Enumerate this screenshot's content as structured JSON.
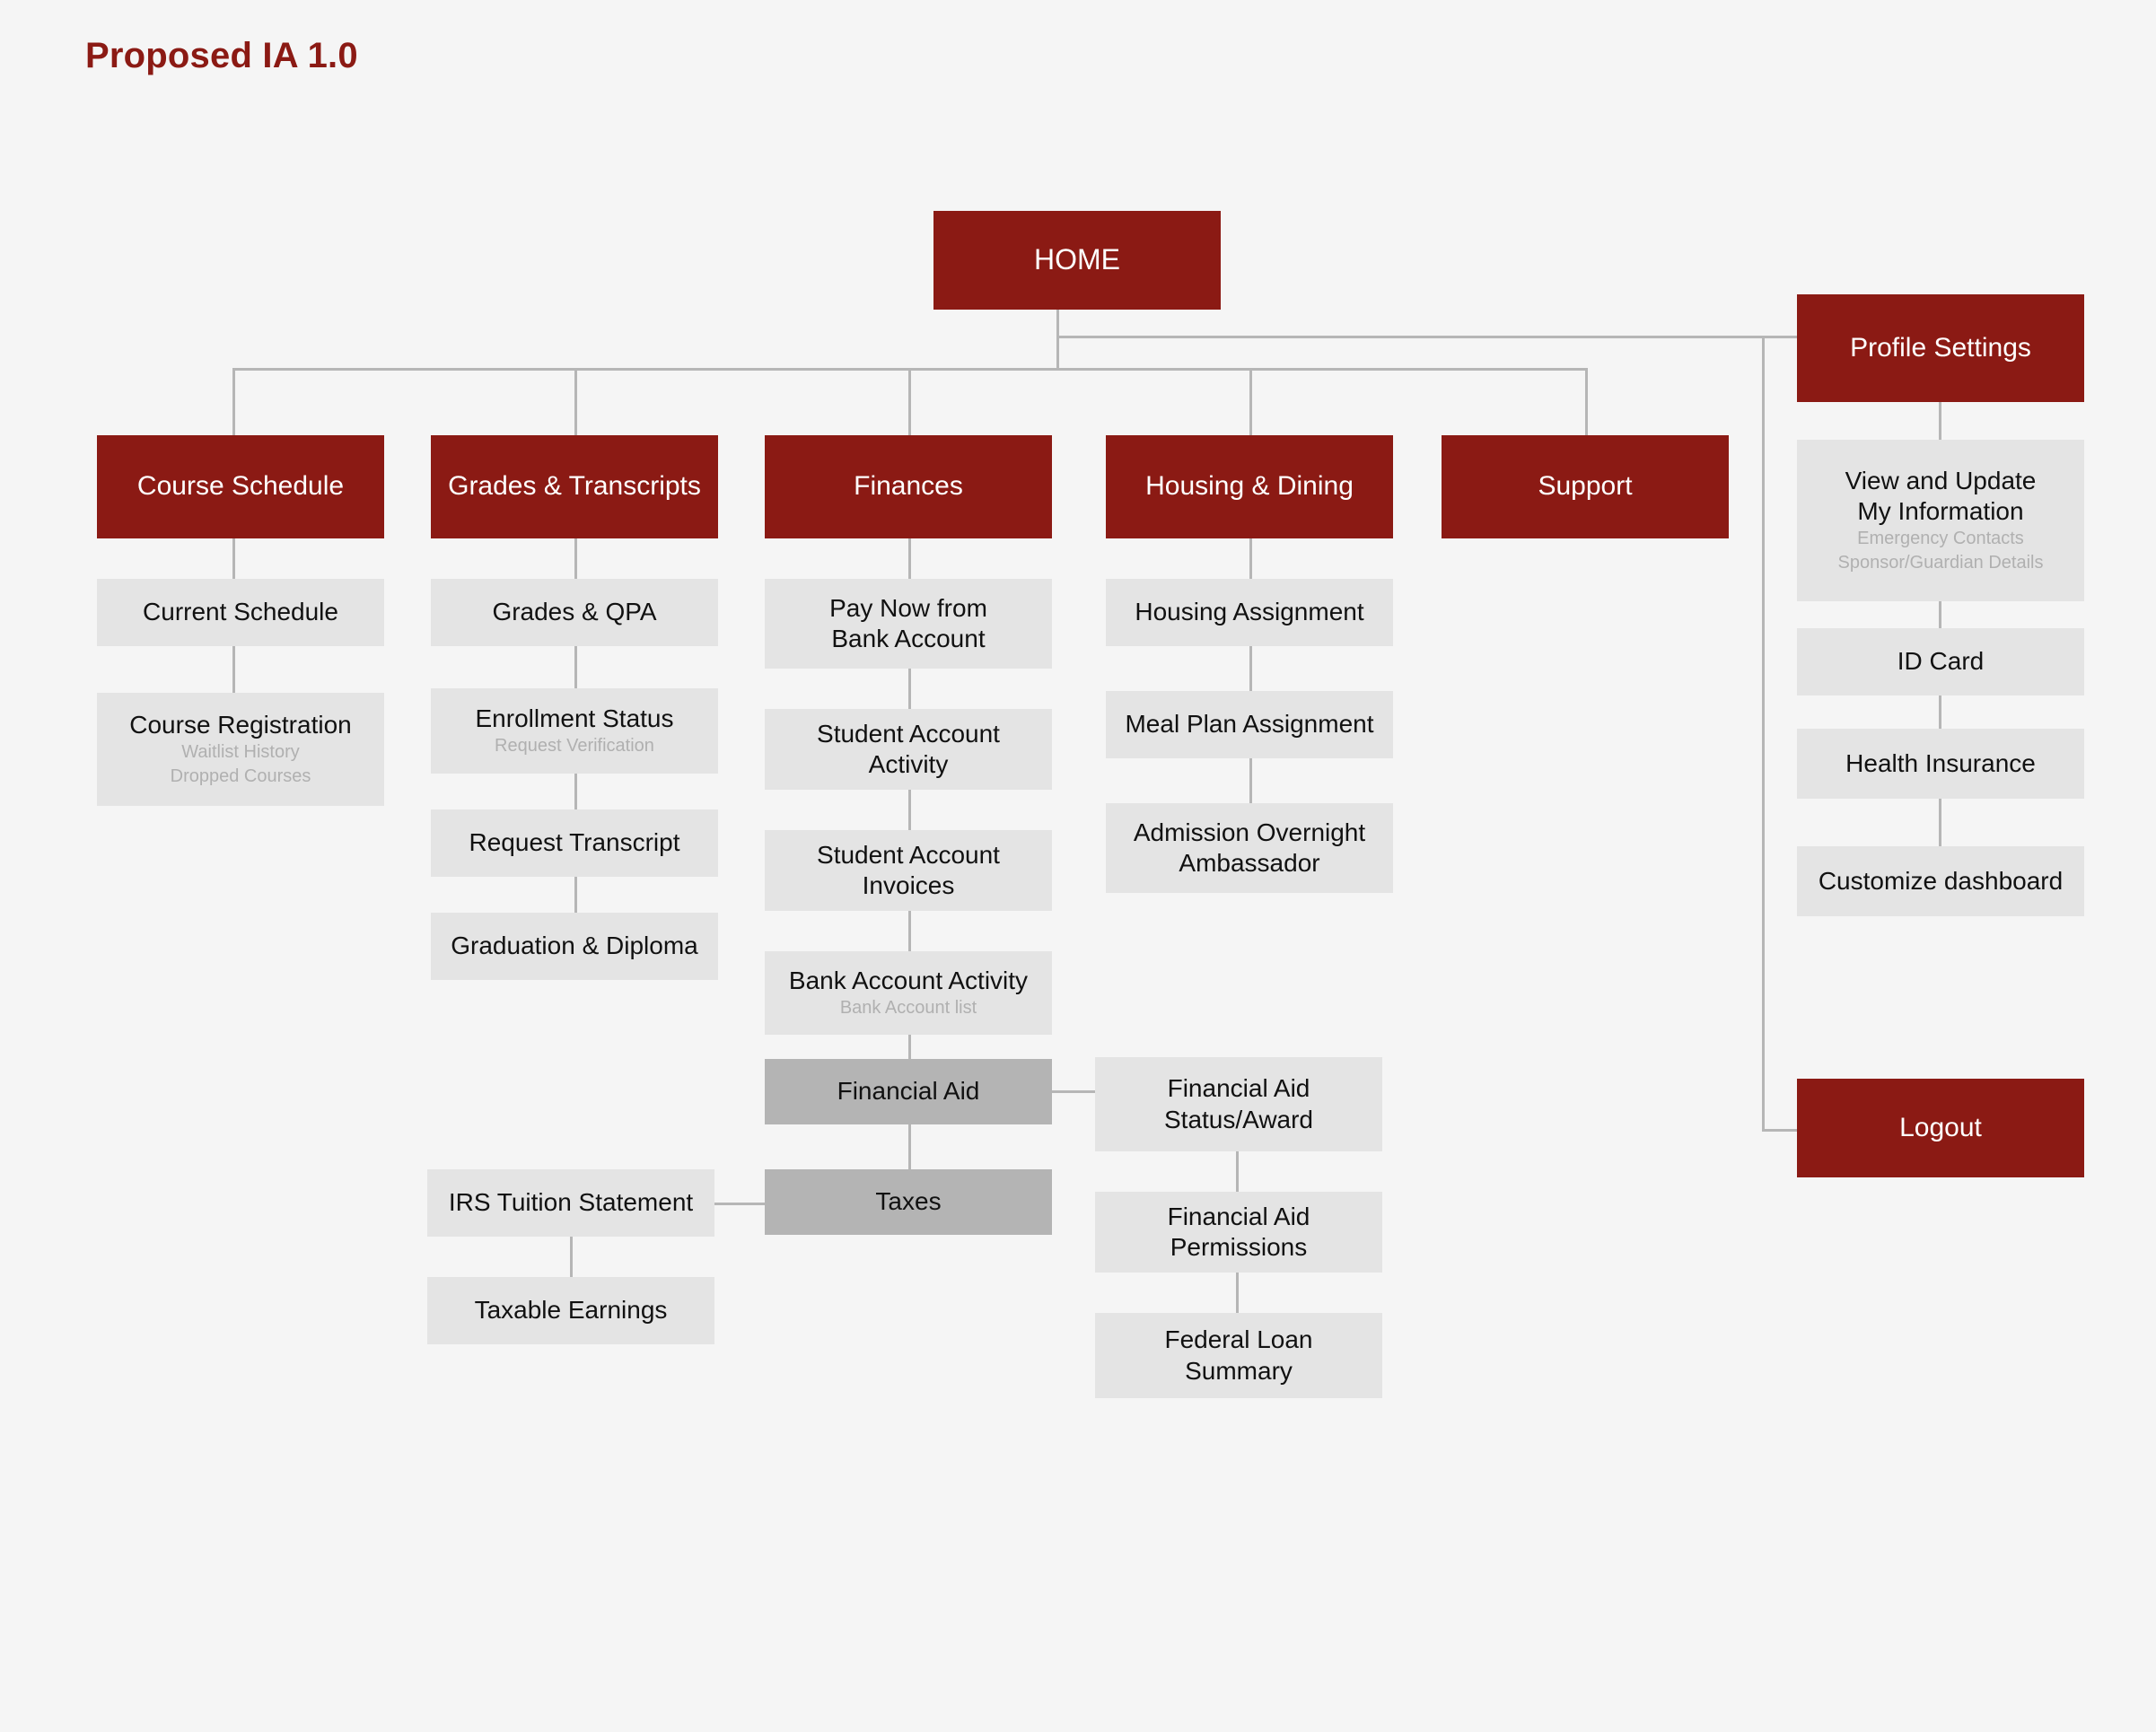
{
  "page": {
    "title": "Proposed IA 1.0",
    "background_color": "#f5f5f5"
  },
  "colors": {
    "primary_red": "#8B1A14",
    "light_box": "#e4e4e4",
    "dark_box": "#b4b4b4",
    "connector": "#b6b6b6",
    "sub_text": "#b0b0b0",
    "text": "#111111",
    "red_text": "#ffffff"
  },
  "root": {
    "label": "HOME"
  },
  "top_level": [
    {
      "label": "Course Schedule"
    },
    {
      "label": "Grades & Transcripts"
    },
    {
      "label": "Finances"
    },
    {
      "label": "Housing & Dining"
    },
    {
      "label": "Support"
    },
    {
      "label": "Profile Settings"
    }
  ],
  "course_schedule": {
    "parent": "Course Schedule",
    "children": [
      {
        "label": "Current Schedule",
        "sub": []
      },
      {
        "label": "Course Registration",
        "sub": [
          "Waitlist History",
          "Dropped Courses"
        ]
      }
    ]
  },
  "grades_transcripts": {
    "parent": "Grades & Transcripts",
    "children": [
      {
        "label": "Grades & QPA",
        "sub": []
      },
      {
        "label": "Enrollment Status",
        "sub": [
          "Request Verification"
        ]
      },
      {
        "label": "Request Transcript",
        "sub": []
      },
      {
        "label": "Graduation & Diploma",
        "sub": []
      }
    ]
  },
  "finances": {
    "parent": "Finances",
    "children": [
      {
        "label": "Pay Now from\nBank Account",
        "line1": "Pay Now from",
        "line2": "Bank Account",
        "sub": []
      },
      {
        "label": "Student Account\nActivity",
        "line1": "Student Account",
        "line2": "Activity",
        "sub": []
      },
      {
        "label": "Student Account\nInvoices",
        "line1": "Student Account",
        "line2": "Invoices",
        "sub": []
      },
      {
        "label": "Bank Account Activity",
        "sub": [
          "Bank Account list"
        ]
      },
      {
        "label": "Financial Aid",
        "sub": [],
        "style": "dark"
      },
      {
        "label": "Taxes",
        "sub": [],
        "style": "dark"
      }
    ]
  },
  "financial_aid": {
    "parent": "Financial Aid",
    "children": [
      {
        "line1": "Financial Aid",
        "line2": "Status/Award"
      },
      {
        "line1": "Financial Aid",
        "line2": "Permissions"
      },
      {
        "line1": "Federal Loan",
        "line2": "Summary"
      }
    ]
  },
  "taxes": {
    "parent": "Taxes",
    "children": [
      {
        "label": "IRS Tuition Statement"
      },
      {
        "label": "Taxable Earnings"
      }
    ]
  },
  "housing_dining": {
    "parent": "Housing & Dining",
    "children": [
      {
        "label": "Housing Assignment",
        "sub": []
      },
      {
        "label": "Meal Plan Assignment",
        "sub": []
      },
      {
        "line1": "Admission Overnight",
        "line2": "Ambassador",
        "sub": []
      }
    ]
  },
  "support": {
    "parent": "Support",
    "children": []
  },
  "profile_settings": {
    "parent": "Profile Settings",
    "children": [
      {
        "line1": "View and Update",
        "line2": "My Information",
        "sub": [
          "Emergency Contacts",
          "Sponsor/Guardian Details"
        ]
      },
      {
        "label": "ID Card",
        "sub": []
      },
      {
        "label": "Health Insurance",
        "sub": []
      },
      {
        "label": "Customize dashboard",
        "sub": []
      }
    ],
    "logout": {
      "label": "Logout"
    }
  }
}
